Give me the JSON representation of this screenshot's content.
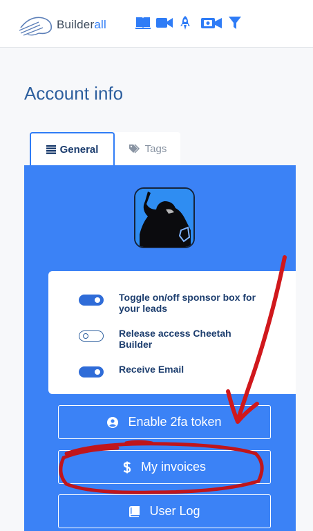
{
  "header": {
    "brand_prefix": "Builder",
    "brand_suffix": "all",
    "icons": [
      "book-icon",
      "video-camera-icon",
      "rocket-icon",
      "video-call-icon",
      "funnel-icon"
    ]
  },
  "page": {
    "title": "Account info"
  },
  "tabs": [
    {
      "label": "General",
      "icon": "list-icon",
      "active": true
    },
    {
      "label": "Tags",
      "icon": "tags-icon",
      "active": false
    }
  ],
  "toggles": [
    {
      "label": "Toggle on/off sponsor box for your leads",
      "on": true
    },
    {
      "label": "Release access Cheetah Builder",
      "on": false
    },
    {
      "label": "Receive Email",
      "on": true
    }
  ],
  "buttons": [
    {
      "label": "Enable 2fa token",
      "icon": "user-circle-icon"
    },
    {
      "label": "My invoices",
      "icon": "dollar-icon"
    },
    {
      "label": "User Log",
      "icon": "book-icon"
    }
  ],
  "colors": {
    "accent": "#3b82f6",
    "title": "#2d5f9e",
    "annotation": "#d0181c"
  }
}
